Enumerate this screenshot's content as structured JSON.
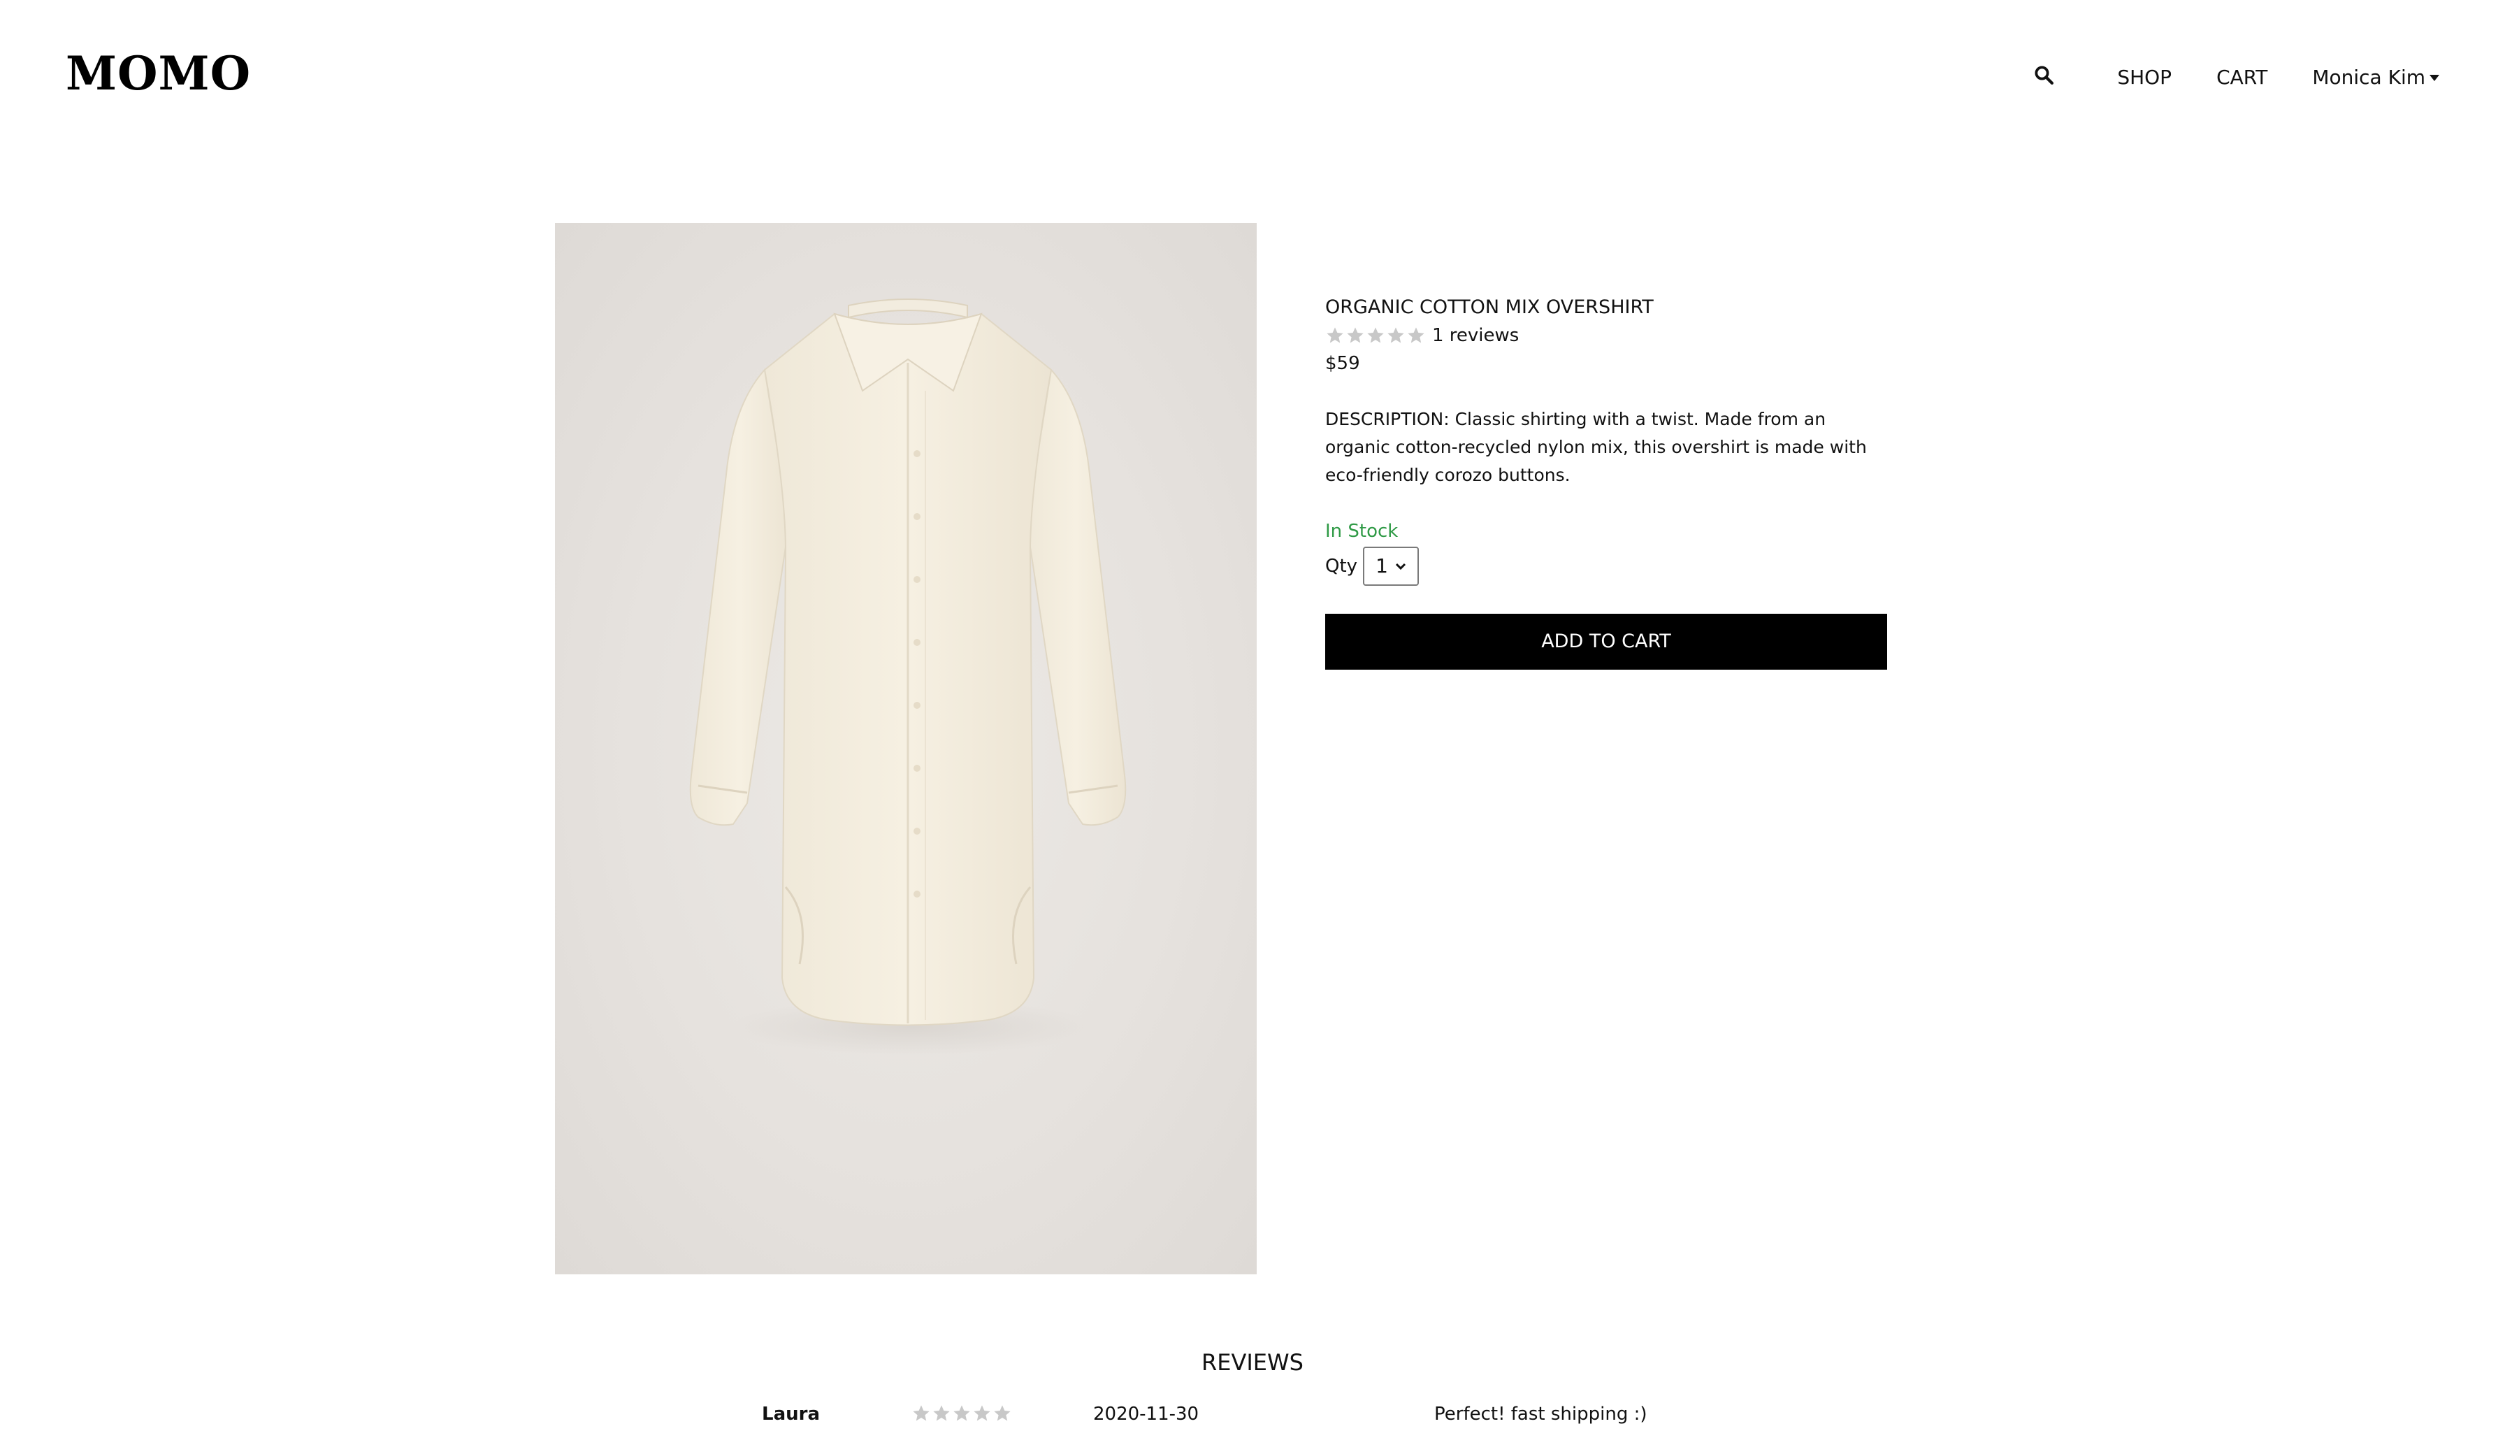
{
  "header": {
    "logo": "MOMO",
    "nav": {
      "shop": "SHOP",
      "cart": "CART",
      "user": "Monica Kim"
    }
  },
  "product": {
    "title": "ORGANIC COTTON MIX OVERSHIRT",
    "rating": 0,
    "reviews_count": "1 reviews",
    "price": "$59",
    "description": "DESCRIPTION: Classic shirting with a twist. Made from an organic cotton-recycled nylon mix, this overshirt is made with eco-friendly corozo buttons.",
    "stock_status": "In Stock",
    "stock_color": "#2f9a46",
    "qty_label": "Qty",
    "qty_value": "1",
    "add_to_cart": "ADD TO CART"
  },
  "reviews": {
    "title": "REVIEWS",
    "items": [
      {
        "author": "Laura",
        "rating": 0,
        "date": "2020-11-30",
        "text": "Perfect! fast shipping :)"
      }
    ]
  }
}
